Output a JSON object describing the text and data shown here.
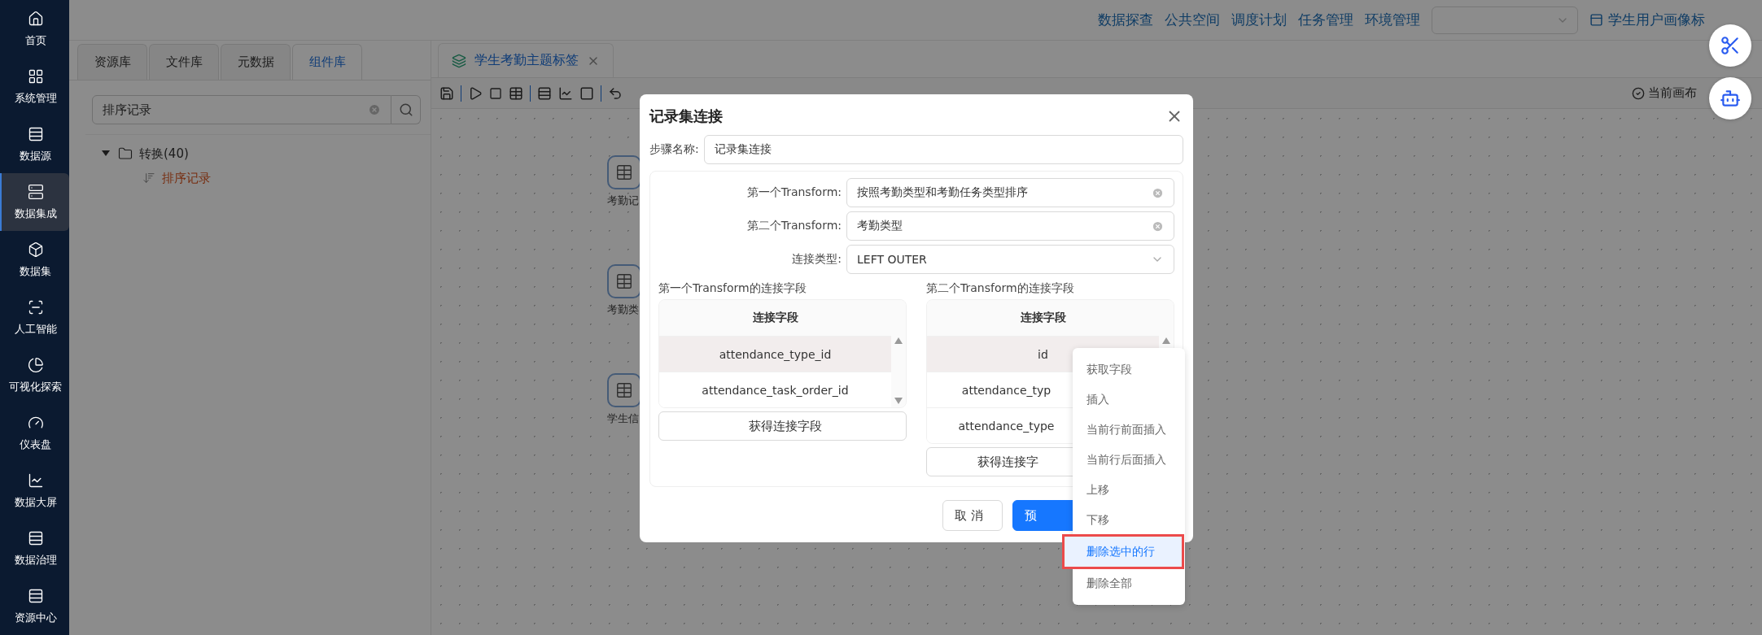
{
  "sidebar": {
    "items": [
      {
        "label": "首页",
        "selected": false
      },
      {
        "label": "系统管理",
        "selected": false
      },
      {
        "label": "数据源",
        "selected": false
      },
      {
        "label": "数据集成",
        "selected": true
      },
      {
        "label": "数据集",
        "selected": false
      },
      {
        "label": "人工智能",
        "selected": false
      },
      {
        "label": "可视化探索",
        "selected": false
      },
      {
        "label": "仪表盘",
        "selected": false
      },
      {
        "label": "数据大屏",
        "selected": false
      },
      {
        "label": "数据治理",
        "selected": false
      },
      {
        "label": "资源中心",
        "selected": false
      }
    ]
  },
  "top_nav": {
    "links": [
      "数据探查",
      "公共空间",
      "调度计划",
      "任务管理",
      "环境管理"
    ],
    "project": "学生用户画像标"
  },
  "left_panel": {
    "tabs": [
      {
        "label": "资源库",
        "selected": false
      },
      {
        "label": "文件库",
        "selected": false
      },
      {
        "label": "元数据",
        "selected": false
      },
      {
        "label": "组件库",
        "selected": true
      }
    ],
    "search": {
      "value": "排序记录"
    },
    "tree": [
      {
        "label": "转换(40)",
        "expanded": true,
        "children": [
          {
            "label": "排序记录",
            "selected": true
          }
        ]
      }
    ]
  },
  "editor": {
    "tab": {
      "label": "学生考勤主题标签"
    },
    "status": "当前画布",
    "nodes": [
      {
        "label": "考勤记"
      },
      {
        "label": "考勤类"
      },
      {
        "label": "学生信"
      }
    ]
  },
  "dialog": {
    "title": "记录集连接",
    "step_name_label": "步骤名称:",
    "step_name": "记录集连接",
    "fields": [
      {
        "label": "第一个Transform:",
        "value": "按照考勤类型和考勤任务类型排序",
        "kind": "clearable"
      },
      {
        "label": "第二个Transform:",
        "value": "考勤类型",
        "kind": "clearable"
      },
      {
        "label": "连接类型:",
        "value": "LEFT OUTER",
        "kind": "select"
      }
    ],
    "tables": [
      {
        "title": "第一个Transform的连接字段",
        "header": "连接字段",
        "rows": [
          {
            "value": "attendance_type_id",
            "selected": true
          },
          {
            "value": "attendance_task_order_id",
            "selected": false
          }
        ],
        "button": "获得连接字段"
      },
      {
        "title": "第二个Transform的连接字段",
        "header": "连接字段",
        "rows": [
          {
            "value": "id",
            "selected": true
          },
          {
            "value": "attendance_typ",
            "selected": false
          },
          {
            "value": "attendance_type",
            "selected": false
          }
        ],
        "button": "获得连接字"
      }
    ],
    "buttons": [
      {
        "label": "取 消",
        "kind": "default"
      },
      {
        "label": "预",
        "kind": "primary"
      }
    ]
  },
  "context_menu": {
    "items": [
      {
        "label": "获取字段",
        "selected": false
      },
      {
        "label": "插入",
        "selected": false
      },
      {
        "label": "当前行前面插入",
        "selected": false
      },
      {
        "label": "当前行后面插入",
        "selected": false
      },
      {
        "label": "上移",
        "selected": false
      },
      {
        "label": "下移",
        "selected": false
      },
      {
        "label": "删除选中的行",
        "selected": true
      },
      {
        "label": "删除全部",
        "selected": false
      }
    ]
  }
}
